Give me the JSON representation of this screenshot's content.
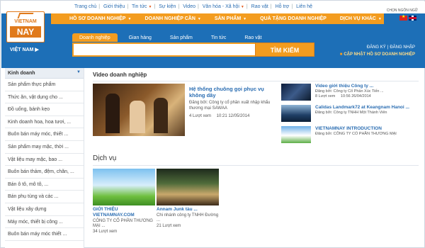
{
  "top_links": [
    "Trang chủ",
    "Giới thiệu",
    "Tin tức",
    "Sự kiện",
    "Video",
    "Văn hóa - Xã hội",
    "Rao vặt",
    "Hỗ trợ",
    "Liên hệ"
  ],
  "language_label": "CHỌN NGÔN NGỮ",
  "main_nav": [
    "HỒ SƠ DOANH NGHIỆP",
    "DOANH NGHIỆP CẦN",
    "SẢN PHẨM",
    "QUÀ TẶNG DOANH NGHIỆP",
    "DỊCH VỤ KHÁC"
  ],
  "logo": {
    "top": "VIETNAM",
    "bottom": "NAY"
  },
  "region": "VIỆT NAM",
  "search": {
    "tabs": [
      "Doanh nghiệp",
      "Gian hàng",
      "Sản phẩm",
      "Tin tức",
      "Rao vặt"
    ],
    "value": "",
    "button": "TÌM KIẾM"
  },
  "auth": {
    "register": "ĐĂNG KÝ",
    "login": "ĐĂNG NHẬP",
    "update": "CẬP NHẬT HỒ SƠ DOANH NGHIỆP"
  },
  "sidebar": {
    "title": "Kinh doanh",
    "items": [
      "Sản phẩm thực phẩm",
      "Thức ăn, vật dụng cho ...",
      "Đồ uống, bánh kẹo",
      "Kinh doanh hoa, hoa tươi, ...",
      "Buôn bán máy móc, thiết ...",
      "Sản phẩm may mặc, thời ...",
      "Vật liệu may mặc, bao ...",
      "Buôn bán thảm, đệm, chăn, ...",
      "Bán ô tô, mô tô, ...",
      "Bán phụ tùng và các ...",
      "Vật liệu xây dựng",
      "Máy móc, thiết bị công ...",
      "Buôn bán máy móc thiết ..."
    ]
  },
  "video_section": {
    "title": "Video doanh nghiệp",
    "featured": {
      "title": "Hệ thống chuông gọi phục vụ không dây",
      "owner": "Đăng bởi: Công ty cổ phần xuất nhập khẩu thương mại SAWAA",
      "views": "4 Lượt xem",
      "time": "10:21 12/05/2014"
    },
    "list": [
      {
        "title": "Video giới thiệu Công ty ...",
        "owner": "Đăng bởi: Công ty Cổ Phần Xúc Tiến ...",
        "views": "8 Lượt xem",
        "time": "10:56 26/04/2014"
      },
      {
        "title": "Calidas Landmark72 at Keangnam Hanoi ...",
        "owner": "Đăng bởi: Công ty TNHH Một Thành Viên",
        "views": "",
        "time": ""
      },
      {
        "title": "VIETNAMNAY INTRODUCTION",
        "owner": "Đăng bởi: CÔNG TY CỔ PHẦN THƯƠNG MẠI",
        "views": "",
        "time": ""
      }
    ]
  },
  "services_section": {
    "title": "Dịch vụ",
    "items": [
      {
        "title": "GIỚI THIỆU",
        "title2": "VIETNAMNAY.COM",
        "owner": "CÔNG TY CỔ PHẦN THƯƠNG MẠI ...",
        "views": "34 Lượt xem"
      },
      {
        "title": "Annam Junk tàu ...",
        "title2": "",
        "owner": "Chi nhánh công ty TNHH Đường ...",
        "views": "21 Lượt xem"
      }
    ]
  },
  "colors": {
    "header_blue": "#1d6fb7",
    "accent_orange": "#f39c1f",
    "link_blue": "#2a6db2"
  }
}
